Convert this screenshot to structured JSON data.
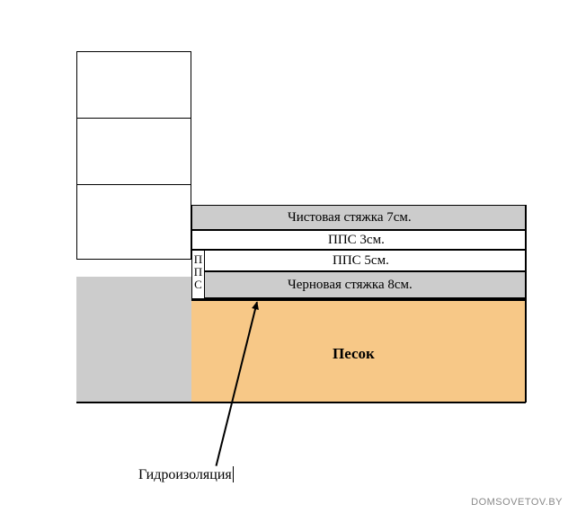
{
  "layers": {
    "screed_top": {
      "label": "Чистовая стяжка 7см."
    },
    "pps_upper": {
      "label": "ППС 3см."
    },
    "pps_lower": {
      "label": "ППС 5см."
    },
    "rough_screed": {
      "label": "Черновая стяжка 8см."
    },
    "pps_vertical": {
      "letters": [
        "П",
        "П",
        "С"
      ]
    },
    "sand": {
      "label": "Песок"
    }
  },
  "annotations": {
    "waterproofing": "Гидроизоляция"
  },
  "watermark": "DOMSOVETOV.BY"
}
